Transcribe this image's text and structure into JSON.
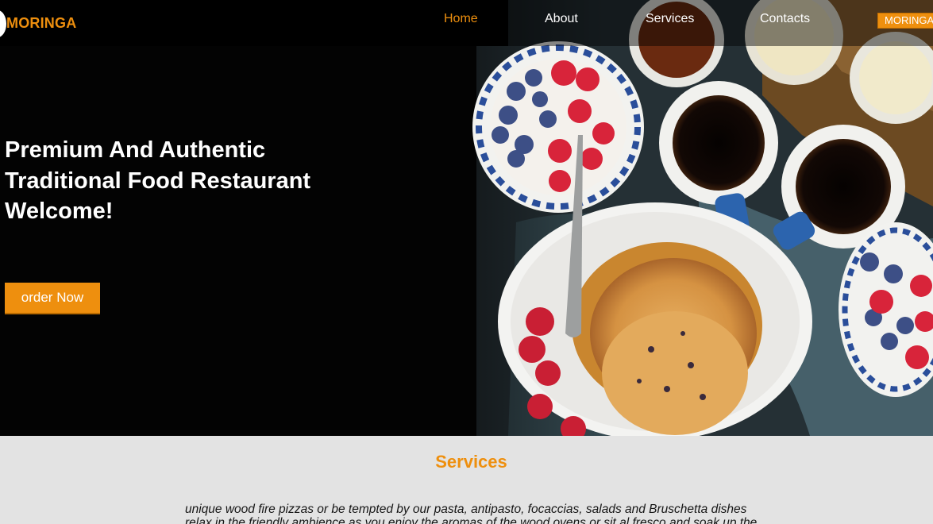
{
  "header": {
    "logo_text": "MORINGA",
    "nav": [
      {
        "label": "Home",
        "active": true
      },
      {
        "label": "About",
        "active": false
      },
      {
        "label": "Services",
        "active": false
      },
      {
        "label": "Contacts",
        "active": false
      }
    ],
    "brand_button_label": "MORINGA"
  },
  "hero": {
    "title_lines": [
      "Premium And Authentic",
      "Traditional Food Restaurant",
      "Welcome!"
    ],
    "cta_label": "order Now"
  },
  "services": {
    "title": "Services",
    "text_lines": [
      "unique wood fire pizzas or be tempted by our pasta, antipasto, focaccias, salads and Bruschetta dishes",
      "relax in the friendly ambience as you enjoy the aromas of the wood ovens or sit al fresco and soak up the"
    ]
  },
  "colors": {
    "accent": "#ee8f0e",
    "hero_bg": "#030303",
    "section_bg": "#e3e3e3"
  }
}
